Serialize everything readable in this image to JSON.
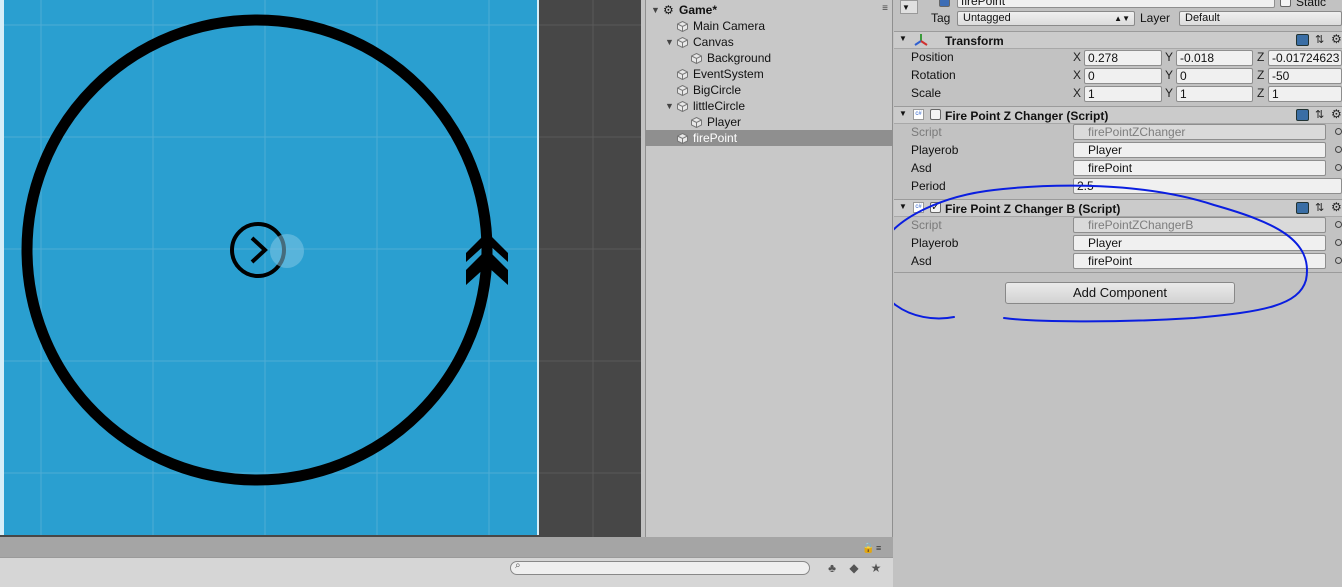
{
  "hierarchy": {
    "scene_title": "Game*",
    "items": [
      {
        "label": "Main Camera",
        "depth": 1,
        "expandable": false
      },
      {
        "label": "Canvas",
        "depth": 1,
        "expandable": true
      },
      {
        "label": "Background",
        "depth": 2,
        "expandable": false
      },
      {
        "label": "EventSystem",
        "depth": 1,
        "expandable": false
      },
      {
        "label": "BigCircle",
        "depth": 1,
        "expandable": false
      },
      {
        "label": "littleCircle",
        "depth": 1,
        "expandable": true
      },
      {
        "label": "Player",
        "depth": 2,
        "expandable": false
      },
      {
        "label": "firePoint",
        "depth": 1,
        "expandable": false
      }
    ],
    "selected": "firePoint"
  },
  "inspector": {
    "object": {
      "name": "firePoint",
      "static_label": "Static",
      "tag_label": "Tag",
      "tag_value": "Untagged",
      "layer_label": "Layer",
      "layer_value": "Default"
    },
    "transform": {
      "title": "Transform",
      "rows": [
        {
          "label": "Position",
          "x": "0.278",
          "y": "-0.018",
          "z": "-0.01724623"
        },
        {
          "label": "Rotation",
          "x": "0",
          "y": "0",
          "z": "-50"
        },
        {
          "label": "Scale",
          "x": "1",
          "y": "1",
          "z": "1"
        }
      ],
      "axis_x": "X",
      "axis_y": "Y",
      "axis_z": "Z"
    },
    "component1": {
      "title": "Fire Point Z Changer (Script)",
      "enabled": false,
      "script_label": "Script",
      "script_value": "firePointZChanger",
      "playerob_label": "Playerob",
      "playerob_value": "Player",
      "asd_label": "Asd",
      "asd_value": "firePoint",
      "period_label": "Period",
      "period_value": "2.5"
    },
    "component2": {
      "title": "Fire Point Z Changer B (Script)",
      "enabled": true,
      "script_label": "Script",
      "script_value": "firePointZChangerB",
      "playerob_label": "Playerob",
      "playerob_value": "Player",
      "asd_label": "Asd",
      "asd_value": "firePoint"
    },
    "add_component_label": "Add Component"
  },
  "colors": {
    "scene_background": "#2a9fd0",
    "annotation_ink": "#0a1ee0",
    "selection": "#8f8f8f"
  }
}
